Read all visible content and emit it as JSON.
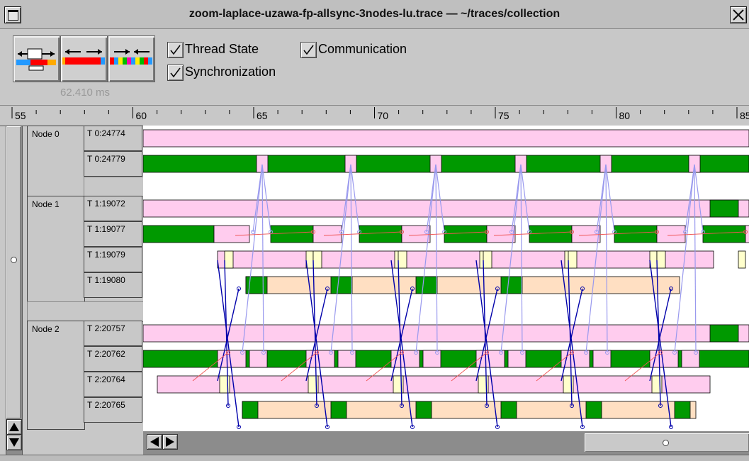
{
  "window": {
    "title": "zoom-laplace-uzawa-fp-allsync-3nodes-lu.trace  —  ~/traces/collection",
    "menu_icon": "window-menu-icon",
    "close_icon": "close-icon"
  },
  "toolbar": {
    "buttons": [
      {
        "name": "thread-state-view-icon"
      },
      {
        "name": "communication-view-icon"
      },
      {
        "name": "synchronization-view-icon"
      }
    ],
    "duration": "62.410 ms",
    "checks": {
      "thread_state": "Thread State",
      "communication": "Communication",
      "synchronization": "Synchronization"
    }
  },
  "ruler": {
    "labels": [
      "55",
      "60",
      "65",
      "70",
      "75",
      "80",
      "85"
    ],
    "range": [
      55,
      85.3
    ]
  },
  "nodes": [
    {
      "label": "Node 0",
      "threads": [
        "T 0:24774",
        "T 0:24779"
      ]
    },
    {
      "label": "Node 1",
      "threads": [
        "T 1:19072",
        "T 1:19077",
        "T 1:19079",
        "T 1:19080"
      ]
    },
    {
      "label": "Node 2",
      "threads": [
        "T 2:20757",
        "T 2:20762",
        "T 2:20764",
        "T 2:20765"
      ]
    }
  ],
  "colors": {
    "running": "#009900",
    "blocked": "#ffccee",
    "waiting": "#ffdfc2",
    "ready": "#ffffcc",
    "sync": "#0000aa",
    "comm_light": "#9999ee",
    "comm_red": "#ee5555"
  },
  "scroll": {
    "up_icon": "arrow-up-icon",
    "down_icon": "arrow-down-icon",
    "left_icon": "arrow-left-icon",
    "right_icon": "arrow-right-icon"
  }
}
